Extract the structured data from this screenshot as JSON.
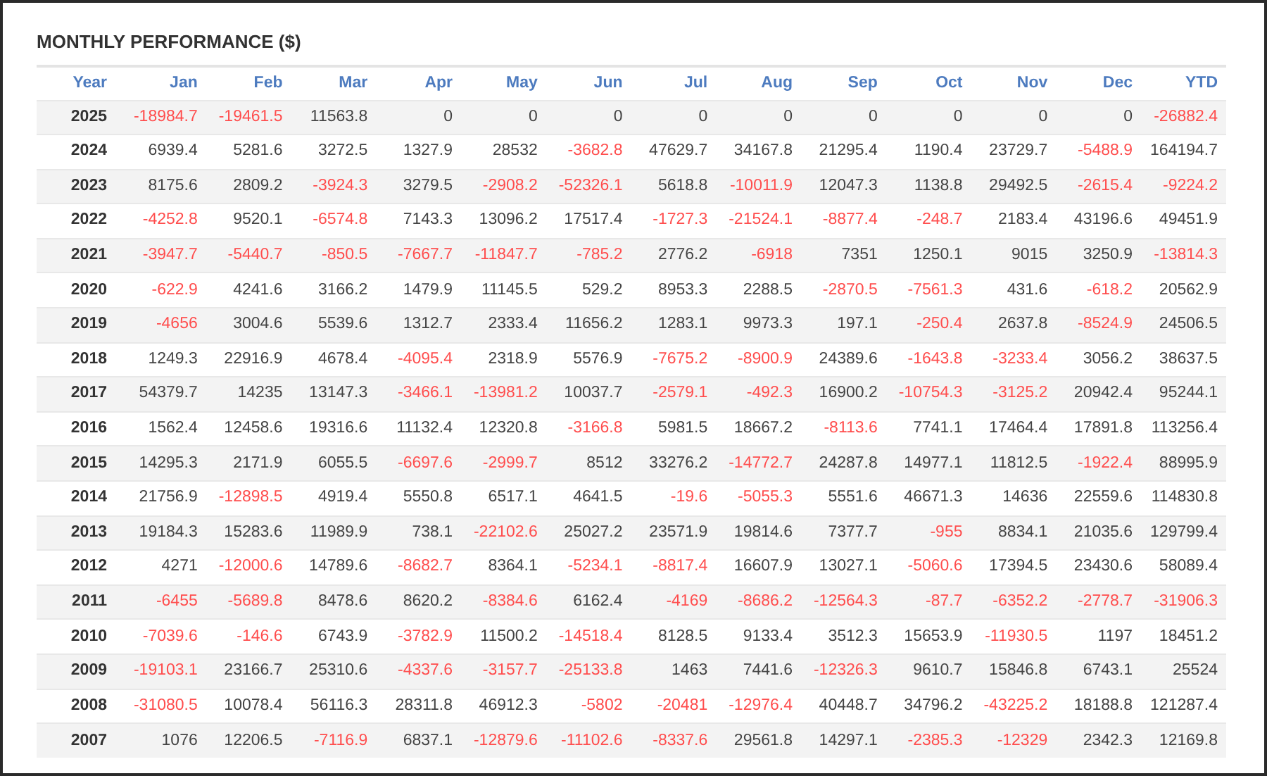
{
  "title": "MONTHLY PERFORMANCE ($)",
  "columns": [
    "Year",
    "Jan",
    "Feb",
    "Mar",
    "Apr",
    "May",
    "Jun",
    "Jul",
    "Aug",
    "Sep",
    "Oct",
    "Nov",
    "Dec",
    "YTD"
  ],
  "rows": [
    [
      "2025",
      "-18984.7",
      "-19461.5",
      "11563.8",
      "0",
      "0",
      "0",
      "0",
      "0",
      "0",
      "0",
      "0",
      "0",
      "-26882.4"
    ],
    [
      "2024",
      "6939.4",
      "5281.6",
      "3272.5",
      "1327.9",
      "28532",
      "-3682.8",
      "47629.7",
      "34167.8",
      "21295.4",
      "1190.4",
      "23729.7",
      "-5488.9",
      "164194.7"
    ],
    [
      "2023",
      "8175.6",
      "2809.2",
      "-3924.3",
      "3279.5",
      "-2908.2",
      "-52326.1",
      "5618.8",
      "-10011.9",
      "12047.3",
      "1138.8",
      "29492.5",
      "-2615.4",
      "-9224.2"
    ],
    [
      "2022",
      "-4252.8",
      "9520.1",
      "-6574.8",
      "7143.3",
      "13096.2",
      "17517.4",
      "-1727.3",
      "-21524.1",
      "-8877.4",
      "-248.7",
      "2183.4",
      "43196.6",
      "49451.9"
    ],
    [
      "2021",
      "-3947.7",
      "-5440.7",
      "-850.5",
      "-7667.7",
      "-11847.7",
      "-785.2",
      "2776.2",
      "-6918",
      "7351",
      "1250.1",
      "9015",
      "3250.9",
      "-13814.3"
    ],
    [
      "2020",
      "-622.9",
      "4241.6",
      "3166.2",
      "1479.9",
      "11145.5",
      "529.2",
      "8953.3",
      "2288.5",
      "-2870.5",
      "-7561.3",
      "431.6",
      "-618.2",
      "20562.9"
    ],
    [
      "2019",
      "-4656",
      "3004.6",
      "5539.6",
      "1312.7",
      "2333.4",
      "11656.2",
      "1283.1",
      "9973.3",
      "197.1",
      "-250.4",
      "2637.8",
      "-8524.9",
      "24506.5"
    ],
    [
      "2018",
      "1249.3",
      "22916.9",
      "4678.4",
      "-4095.4",
      "2318.9",
      "5576.9",
      "-7675.2",
      "-8900.9",
      "24389.6",
      "-1643.8",
      "-3233.4",
      "3056.2",
      "38637.5"
    ],
    [
      "2017",
      "54379.7",
      "14235",
      "13147.3",
      "-3466.1",
      "-13981.2",
      "10037.7",
      "-2579.1",
      "-492.3",
      "16900.2",
      "-10754.3",
      "-3125.2",
      "20942.4",
      "95244.1"
    ],
    [
      "2016",
      "1562.4",
      "12458.6",
      "19316.6",
      "11132.4",
      "12320.8",
      "-3166.8",
      "5981.5",
      "18667.2",
      "-8113.6",
      "7741.1",
      "17464.4",
      "17891.8",
      "113256.4"
    ],
    [
      "2015",
      "14295.3",
      "2171.9",
      "6055.5",
      "-6697.6",
      "-2999.7",
      "8512",
      "33276.2",
      "-14772.7",
      "24287.8",
      "14977.1",
      "11812.5",
      "-1922.4",
      "88995.9"
    ],
    [
      "2014",
      "21756.9",
      "-12898.5",
      "4919.4",
      "5550.8",
      "6517.1",
      "4641.5",
      "-19.6",
      "-5055.3",
      "5551.6",
      "46671.3",
      "14636",
      "22559.6",
      "114830.8"
    ],
    [
      "2013",
      "19184.3",
      "15283.6",
      "11989.9",
      "738.1",
      "-22102.6",
      "25027.2",
      "23571.9",
      "19814.6",
      "7377.7",
      "-955",
      "8834.1",
      "21035.6",
      "129799.4"
    ],
    [
      "2012",
      "4271",
      "-12000.6",
      "14789.6",
      "-8682.7",
      "8364.1",
      "-5234.1",
      "-8817.4",
      "16607.9",
      "13027.1",
      "-5060.6",
      "17394.5",
      "23430.6",
      "58089.4"
    ],
    [
      "2011",
      "-6455",
      "-5689.8",
      "8478.6",
      "8620.2",
      "-8384.6",
      "6162.4",
      "-4169",
      "-8686.2",
      "-12564.3",
      "-87.7",
      "-6352.2",
      "-2778.7",
      "-31906.3"
    ],
    [
      "2010",
      "-7039.6",
      "-146.6",
      "6743.9",
      "-3782.9",
      "11500.2",
      "-14518.4",
      "8128.5",
      "9133.4",
      "3512.3",
      "15653.9",
      "-11930.5",
      "1197",
      "18451.2"
    ],
    [
      "2009",
      "-19103.1",
      "23166.7",
      "25310.6",
      "-4337.6",
      "-3157.7",
      "-25133.8",
      "1463",
      "7441.6",
      "-12326.3",
      "9610.7",
      "15846.8",
      "6743.1",
      "25524"
    ],
    [
      "2008",
      "-31080.5",
      "10078.4",
      "56116.3",
      "28311.8",
      "46912.3",
      "-5802",
      "-20481",
      "-12976.4",
      "40448.7",
      "34796.2",
      "-43225.2",
      "18188.8",
      "121287.4"
    ],
    [
      "2007",
      "1076",
      "12206.5",
      "-7116.9",
      "6837.1",
      "-12879.6",
      "-11102.6",
      "-8337.6",
      "29561.8",
      "14297.1",
      "-2385.3",
      "-12329",
      "2342.3",
      "12169.8"
    ]
  ]
}
